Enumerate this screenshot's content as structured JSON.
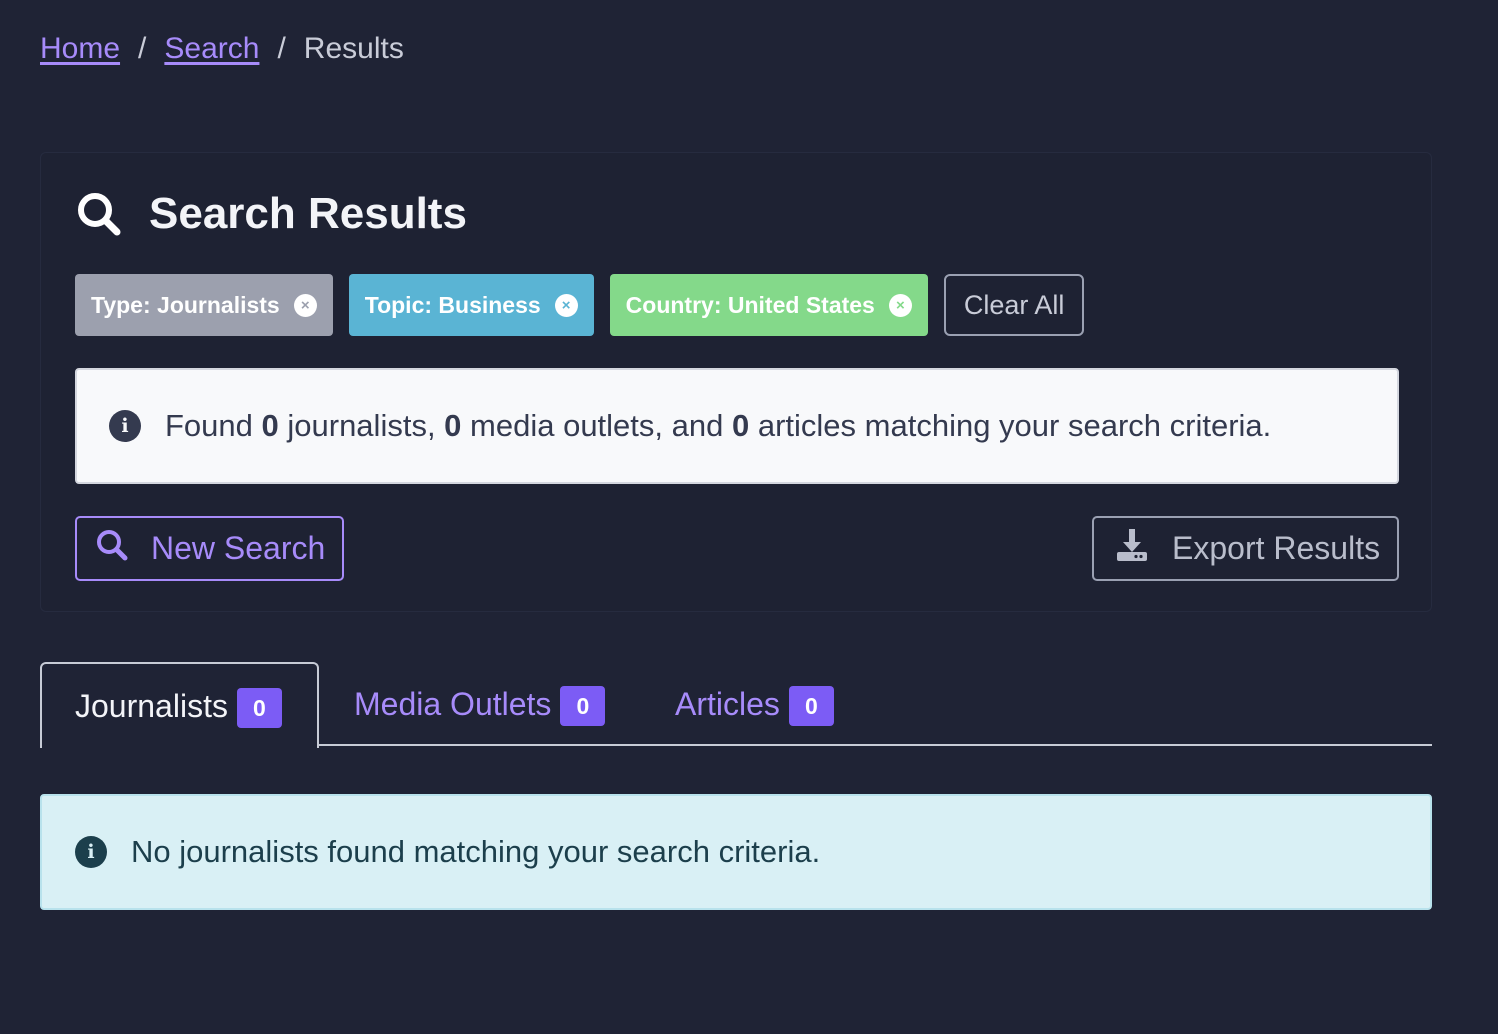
{
  "breadcrumb": {
    "home": "Home",
    "sep1": "/",
    "search": "Search",
    "sep2": "/",
    "current": "Results"
  },
  "card": {
    "title": "Search Results",
    "icon": "search-icon",
    "filters": [
      {
        "label": "Type: Journalists",
        "color": "#9ca0ae"
      },
      {
        "label": "Topic: Business",
        "color": "#5ab4d4"
      },
      {
        "label": "Country: United States",
        "color": "#84d98a"
      }
    ],
    "remove_glyph": "×",
    "clear_all": "Clear All",
    "summary": {
      "prefix": "Found ",
      "journalists_count": "0",
      "mid1": " journalists, ",
      "outlets_count": "0",
      "mid2": " media outlets, and ",
      "articles_count": "0",
      "suffix": " articles matching your search criteria."
    },
    "new_search": "New Search",
    "export": "Export Results"
  },
  "tabs": [
    {
      "label": "Journalists",
      "count": "0",
      "active": true
    },
    {
      "label": "Media Outlets",
      "count": "0",
      "active": false
    },
    {
      "label": "Articles",
      "count": "0",
      "active": false
    }
  ],
  "empty_message": "No journalists found matching your search criteria.",
  "info_glyph": "i",
  "colors": {
    "background": "#1f2335",
    "accent": "#a78bfa",
    "badge": "#7c5cf5",
    "info_alert": "#d9f0f5"
  }
}
